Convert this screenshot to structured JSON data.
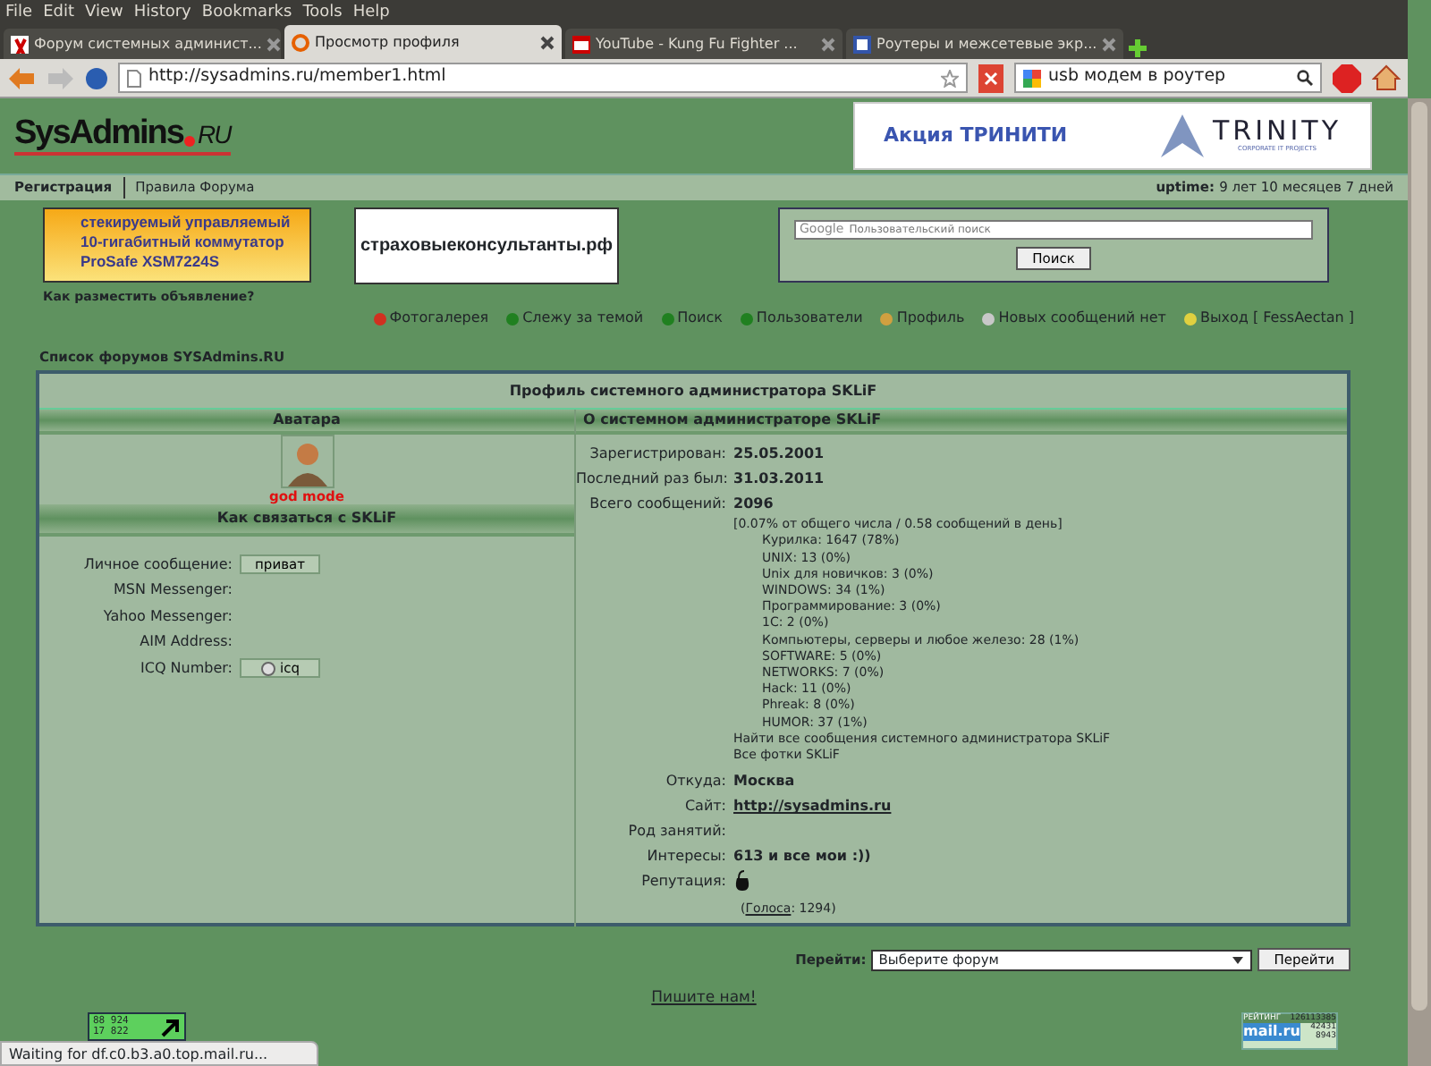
{
  "browser": {
    "menu": [
      "File",
      "Edit",
      "View",
      "History",
      "Bookmarks",
      "Tools",
      "Help"
    ],
    "tabs": [
      {
        "title": "Форум системных админист...",
        "selected": false
      },
      {
        "title": "Просмотр профиля",
        "selected": true
      },
      {
        "title": "YouTube - Kung Fu Fighter ...",
        "selected": false
      },
      {
        "title": "Роутеры и межсетевые экр...",
        "selected": false
      }
    ],
    "address": "http://sysadmins.ru/member1.html",
    "search": "usb модем в роутер"
  },
  "header": {
    "logo": "SysAdmins",
    "logo_suffix": "RU",
    "banner_title": "Акция ТРИНИТИ",
    "banner_brand": "TRINITY",
    "banner_tagline": "CORPORATE IT PROJECTS"
  },
  "topbar": {
    "links": [
      "Регистрация",
      "Правила Форума"
    ],
    "uptime_label": "uptime:",
    "uptime": "9 лет 10 месяцев 7 дней"
  },
  "ads": {
    "switch_ad": [
      "стекируемый управляемый",
      "10-гигабитный коммутатор",
      "ProSafe XSM7224S"
    ],
    "site_ad": "страховыеконсультанты.рф",
    "ad_link": "Как разместить объявление?",
    "search_brand": "Google",
    "search_placeholder": "Пользовательский поиск",
    "search_button": "Поиск"
  },
  "nav": [
    {
      "label": "Фотогалерея",
      "color": "#d03020"
    },
    {
      "label": "Слежу за темой",
      "color": "#208020"
    },
    {
      "label": "Поиск",
      "color": "#208020"
    },
    {
      "label": "Пользователи",
      "color": "#208020"
    },
    {
      "label": "Профиль",
      "color": "#d0a040"
    },
    {
      "label": "Новых сообщений нет",
      "color": "#c8c8c8"
    },
    {
      "label": "Выход [ FessAectan ]",
      "color": "#e0d040"
    }
  ],
  "breadcrumb": "Список форумов SYSAdmins.RU",
  "profile": {
    "title": "Профиль системного администратора SKLiF",
    "avatar_header": "Аватара",
    "about_header": "О системном администраторе SKLiF",
    "avatar_caption": "god mode",
    "contact_header": "Как связаться с SKLiF",
    "contacts": [
      {
        "label": "Личное сообщение:",
        "button": "приват",
        "kind": "button"
      },
      {
        "label": "MSN Messenger:"
      },
      {
        "label": "Yahoo Messenger:"
      },
      {
        "label": "AIM Address:"
      },
      {
        "label": "ICQ Number:",
        "button": "icq",
        "kind": "icq"
      }
    ],
    "registered_label": "Зарегистрирован:",
    "registered": "25.05.2001",
    "last_label": "Последний раз был:",
    "last": "31.03.2011",
    "posts_label": "Всего сообщений:",
    "posts": "2096",
    "posts_ratio": "[0.07% от общего числа / 0.58 сообщений в день]",
    "forums": [
      "Курилка: 1647 (78%)",
      "UNIX: 13 (0%)",
      "Unix для новичков: 3 (0%)",
      "WINDOWS: 34 (1%)",
      "Программирование: 3 (0%)",
      "1C: 2 (0%)",
      "Компьютеры, серверы и любое железо: 28 (1%)",
      "SOFTWARE: 5 (0%)",
      "NETWORKS: 7 (0%)",
      "Hack: 11 (0%)",
      "Phreak: 8 (0%)",
      "HUMOR: 37 (1%)"
    ],
    "find_posts": "Найти все сообщения системного администратора SKLiF",
    "photos": "Все фотки SKLiF",
    "fields": [
      {
        "label": "Откуда:",
        "value": "Москва",
        "kind": "text"
      },
      {
        "label": "Сайт:",
        "value": "http://sysadmins.ru",
        "kind": "link"
      },
      {
        "label": "Род занятий:",
        "kind": "text"
      },
      {
        "label": "Интересы:",
        "value": "613 и все мои :))",
        "kind": "text"
      }
    ],
    "reputation_label": "Репутация:",
    "votes_link": "Голоса",
    "votes": ": 1294)",
    "votes_open": "("
  },
  "jump": {
    "label": "Перейти:",
    "select": "Выберите форум",
    "button": "Перейти"
  },
  "write_us": "Пишите нам!",
  "counter_left": [
    "88 924",
    "17 822"
  ],
  "counter_right": {
    "top": "РЕЙТИНГ",
    "count": "126113385",
    "brand": "mail.ru",
    "n1": "42431",
    "n2": "8943"
  },
  "status": "Waiting for df.c0.b3.a0.top.mail.ru..."
}
